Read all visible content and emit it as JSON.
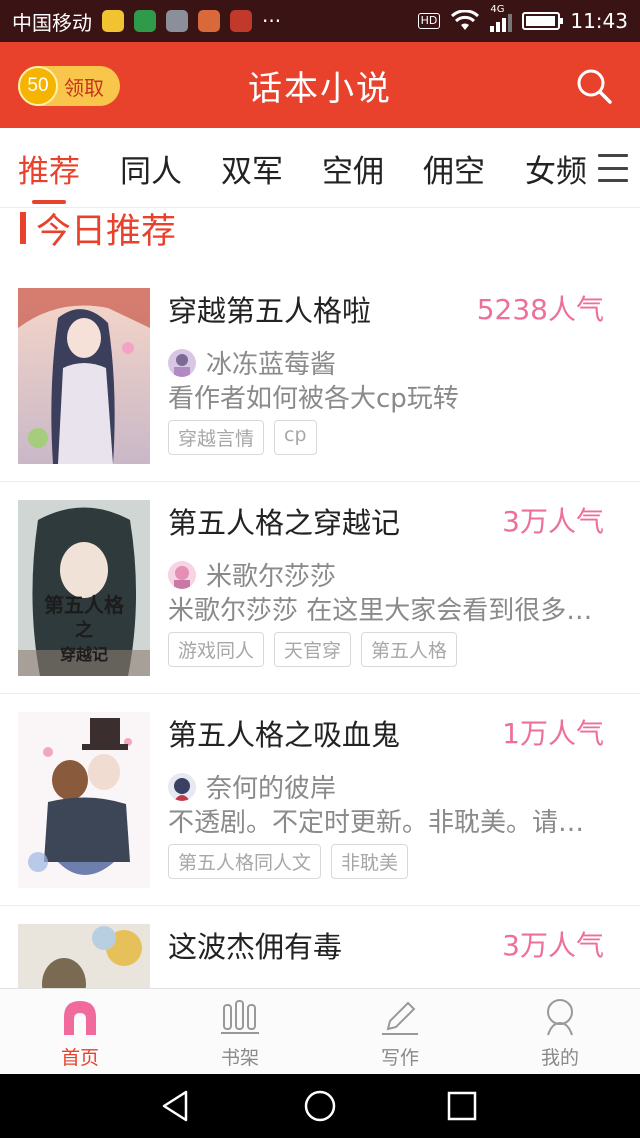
{
  "status_bar": {
    "carrier": "中国移动",
    "more": "···",
    "hd": "HD",
    "network": "4G",
    "time": "11:43"
  },
  "header": {
    "coin_amount": "50",
    "coin_label": "领取",
    "title": "话本小说"
  },
  "tabs": [
    {
      "label": "推荐",
      "active": true
    },
    {
      "label": "同人",
      "active": false
    },
    {
      "label": "双军",
      "active": false
    },
    {
      "label": "空佣",
      "active": false
    },
    {
      "label": "佣空",
      "active": false
    },
    {
      "label": "女频",
      "active": false
    }
  ],
  "section": {
    "title": "今日推荐"
  },
  "books": [
    {
      "title": "穿越第五人格啦",
      "popularity": "5238人气",
      "author": "冰冻蓝莓酱",
      "description": "看作者如何被各大cp玩转",
      "tags": [
        "穿越言情",
        "cp"
      ]
    },
    {
      "title": "第五人格之穿越记",
      "popularity": "3万人气",
      "author": "米歌尔莎莎",
      "description": "米歌尔莎莎 在这里大家会看到很多很多",
      "tags": [
        "游戏同人",
        "天官穿",
        "第五人格"
      ],
      "cover_text": [
        "第五人格",
        "之",
        "穿越记"
      ]
    },
    {
      "title": "第五人格之吸血鬼",
      "popularity": "1万人气",
      "author": "奈何的彼岸",
      "description": "不透剧。不定时更新。非耽美。请多指教",
      "tags": [
        "第五人格同人文",
        "非耽美"
      ]
    },
    {
      "title": "这波杰佣有毒",
      "popularity": "3万人气"
    }
  ],
  "bottom_nav": [
    {
      "label": "首页",
      "icon": "home-icon",
      "active": true
    },
    {
      "label": "书架",
      "icon": "bookshelf-icon",
      "active": false
    },
    {
      "label": "写作",
      "icon": "pen-icon",
      "active": false
    },
    {
      "label": "我的",
      "icon": "profile-icon",
      "active": false
    }
  ],
  "colors": {
    "accent": "#e8412c",
    "popularity": "#ee6f9c",
    "status_bar": "#3a1414"
  },
  "battery_level": 0.95
}
